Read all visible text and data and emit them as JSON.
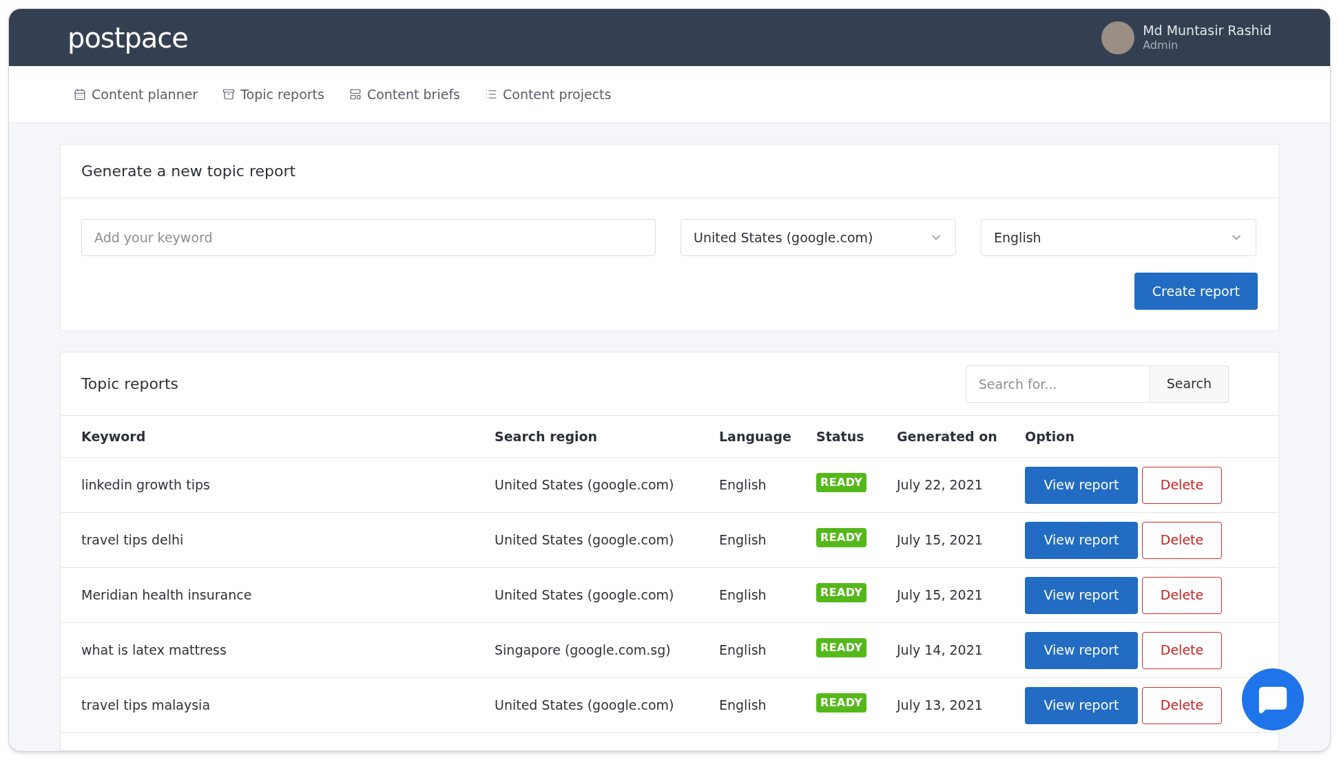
{
  "header": {
    "logo": "postpace",
    "user": {
      "name": "Md Muntasir Rashid",
      "role": "Admin"
    }
  },
  "nav": [
    {
      "label": "Content planner",
      "kind": "calendar"
    },
    {
      "label": "Topic reports",
      "kind": "archive"
    },
    {
      "label": "Content briefs",
      "kind": "layout"
    },
    {
      "label": "Content projects",
      "kind": "list"
    }
  ],
  "generate": {
    "title": "Generate a new topic report",
    "keyword": {
      "placeholder": "Add your keyword"
    },
    "region": "United States (google.com)",
    "language": "English",
    "button": "Create report"
  },
  "reports": {
    "title": "Topic reports",
    "search": {
      "placeholder": "Search for...",
      "button": "Search"
    },
    "columns": [
      "Keyword",
      "Search region",
      "Language",
      "Status",
      "Generated on",
      "Option"
    ],
    "rows": [
      {
        "keyword": "linkedin growth tips",
        "region": "United States (google.com)",
        "language": "English",
        "status": "READY",
        "date": "July 22, 2021",
        "view": "View report",
        "delete": "Delete"
      },
      {
        "keyword": "travel tips delhi",
        "region": "United States (google.com)",
        "language": "English",
        "status": "READY",
        "date": "July 15, 2021",
        "view": "View report",
        "delete": "Delete"
      },
      {
        "keyword": "Meridian health insurance",
        "region": "United States (google.com)",
        "language": "English",
        "status": "READY",
        "date": "July 15, 2021",
        "view": "View report",
        "delete": "Delete"
      },
      {
        "keyword": "what is latex mattress",
        "region": "Singapore (google.com.sg)",
        "language": "English",
        "status": "READY",
        "date": "July 14, 2021",
        "view": "View report",
        "delete": "Delete"
      },
      {
        "keyword": "travel tips malaysia",
        "region": "United States (google.com)",
        "language": "English",
        "status": "READY",
        "date": "July 13, 2021",
        "view": "View report",
        "delete": "Delete"
      }
    ]
  }
}
